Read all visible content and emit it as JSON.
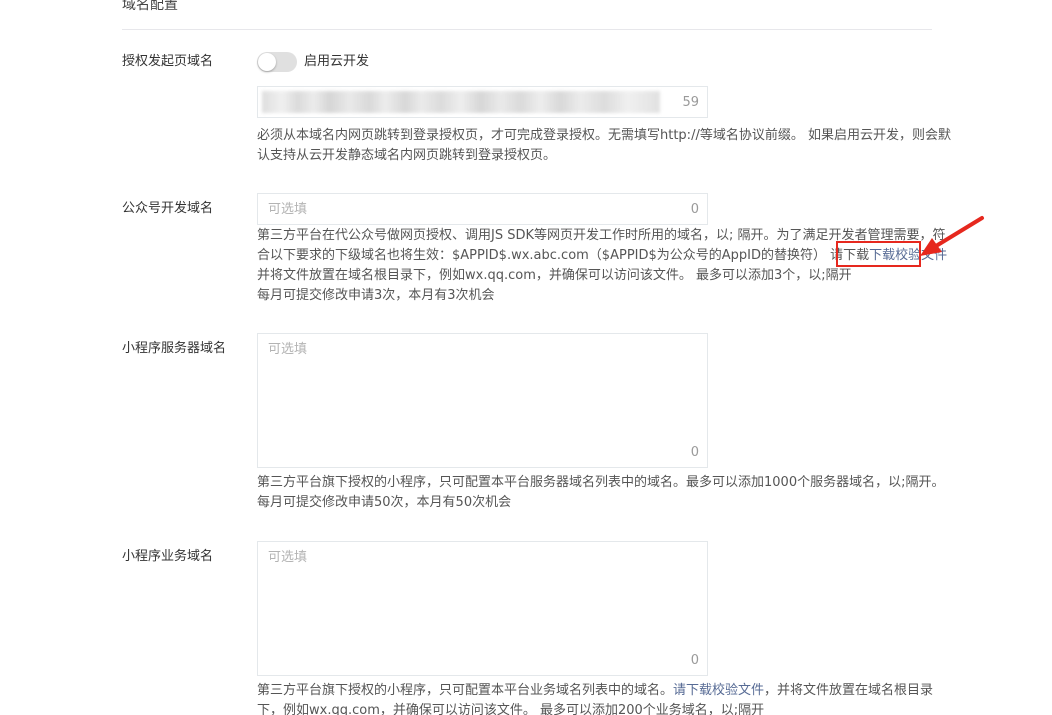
{
  "section": {
    "title": "域名配置"
  },
  "auth_domain": {
    "label": "授权发起页域名",
    "toggle_label": "启用云开发",
    "toggle_on": false,
    "count": "59",
    "desc_lines": [
      "必须从本域名内网页跳转到登录授权页，才可完成登录授权。无需填写http://等域名协议前缀。 如果启用云开发，则会默",
      "认支持从云开发静态域名内网页跳转到登录授权页。"
    ]
  },
  "mp_domain": {
    "label": "公众号开发域名",
    "placeholder": "可选填",
    "count": "0",
    "desc_line1": "第三方平台在代公众号做网页授权、调用JS SDK等网页开发工作时所用的域名，以; 隔开。为了满足开发者管理需要，符",
    "desc_line2_prefix": "合以下要求的下级域名也将生效：$APPID$.wx.abc.com（$APPID$为公众号的AppID的替换符） 请下载",
    "desc_line2_link": "下载校验文件",
    "desc_line3": "并将文件放置在域名根目录下，例如wx.qq.com，并确保可以访问该文件。 最多可以添加3个，以;隔开",
    "desc_line4": "每月可提交修改申请3次，本月有3次机会"
  },
  "miniprogram_server": {
    "label": "小程序服务器域名",
    "placeholder": "可选填",
    "count": "0",
    "desc_line1": "第三方平台旗下授权的小程序，只可配置本平台服务器域名列表中的域名。最多可以添加1000个服务器域名，以;隔开。",
    "desc_line2": "每月可提交修改申请50次，本月有50次机会"
  },
  "miniprogram_business": {
    "label": "小程序业务域名",
    "placeholder": "可选填",
    "count": "0",
    "desc_line1_prefix": "第三方平台旗下授权的小程序，只可配置本平台业务域名列表中的域名。",
    "desc_line1_link": "请下载校验文件",
    "desc_line1_suffix": "，并将文件放置在域名根目录",
    "desc_line2": "下，例如wx.qq.com，并确保可以访问该文件。 最多可以添加200个业务域名，以;隔开"
  },
  "colors": {
    "link": "#576b95",
    "annotation": "#e6281e"
  }
}
